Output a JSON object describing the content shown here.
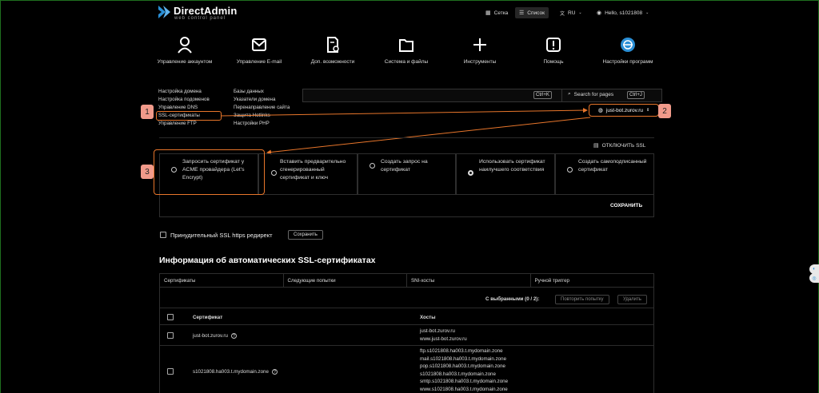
{
  "header": {
    "brand": "DirectAdmin",
    "brand_sub": "web control panel",
    "grid_label": "Сетка",
    "list_label": "Список",
    "lang_label": "RU",
    "user_label": "Hello, s1021808"
  },
  "nav": {
    "items": [
      {
        "label": "Управление аккаунтом",
        "icon": "user-icon"
      },
      {
        "label": "Управление E-mail",
        "icon": "mail-icon"
      },
      {
        "label": "Доп. возможности",
        "icon": "document-gear-icon"
      },
      {
        "label": "Система и файлы",
        "icon": "folder-icon"
      },
      {
        "label": "Инструменты",
        "icon": "plus-icon"
      },
      {
        "label": "Помощь",
        "icon": "help-icon"
      },
      {
        "label": "Настройки программ",
        "icon": "apps-icon"
      }
    ]
  },
  "dropdown": {
    "col1": [
      "Настройка домена",
      "Настройка подоменов",
      "Управление DNS",
      "SSL-сертификаты",
      "Управление FTP"
    ],
    "col2": [
      "Базы данных",
      "Указатели домена",
      "Перенаправление сайта",
      "Защита Hotlinks",
      "Настройки PHP"
    ]
  },
  "search": {
    "shortcut1": "Ctrl+K",
    "label": "Search for pages",
    "shortcut2": "Ctrl+J"
  },
  "domain_selector": "just-bot.zurov.ru",
  "badges": [
    "1",
    "2",
    "3"
  ],
  "ssl_off_label": "ОТКЛЮЧИТЬ SSL",
  "options": [
    "Запросить сертификат у ACME провайдера (Let's Encrypt)",
    "Вставить предварительно сгенерированный сертификат и ключ",
    "Создать запрос на сертификат",
    "Использовать сертификат наилучшего соответствия",
    "Создать самоподписанный сертификат"
  ],
  "selected_option_index": 3,
  "save_label": "СОХРАНИТЬ",
  "redirect": {
    "label": "Принудительный SSL https редирект",
    "button": "Сохранить"
  },
  "section_title": "Информация об автоматических SSL-сертификатах",
  "tabs": [
    "Сертификаты",
    "Следующие попытки",
    "SNI-хосты",
    "Ручной триггер"
  ],
  "table": {
    "selection_label": "С выбранными (0 / 2):",
    "retry_button": "Повторить попытку",
    "delete_button": "Удалить",
    "col_cert": "Сертификат",
    "col_hosts": "Хосты",
    "rows": [
      {
        "cert": "just-bot.zurov.ru",
        "hosts": [
          "just-bot.zurov.ru",
          "www.just-bot.zurov.ru"
        ]
      },
      {
        "cert": "s1021808.ha003.t.mydomain.zone",
        "hosts": [
          "ftp.s1021808.ha003.t.mydomain.zone",
          "mail.s1021808.ha003.t.mydomain.zone",
          "pop.s1021808.ha003.t.mydomain.zone",
          "s1021808.ha003.t.mydomain.zone",
          "smtp.s1021808.ha003.t.mydomain.zone",
          "www.s1021808.ha003.t.mydomain.zone"
        ]
      }
    ]
  },
  "colors": {
    "accent": "#e8762b",
    "badge": "#f19a8a",
    "brand_blue": "#2a8fd6"
  }
}
